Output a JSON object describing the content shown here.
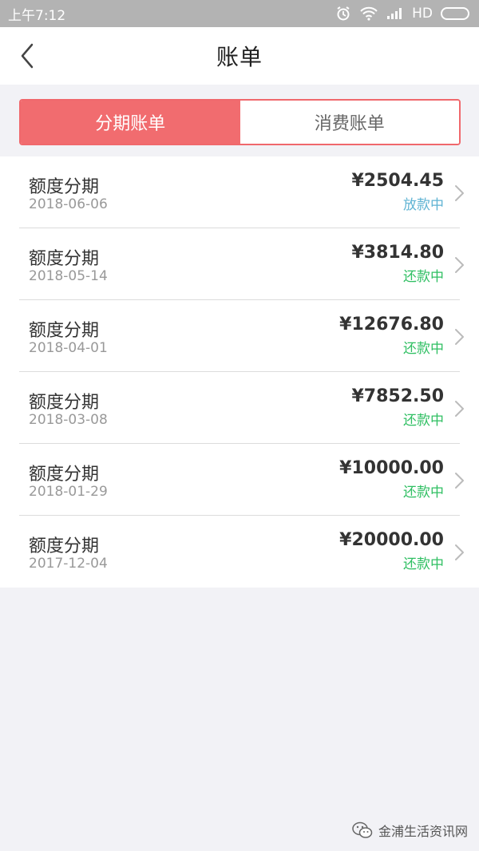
{
  "status_bar": {
    "time": "上午7:12",
    "network": "HD"
  },
  "nav": {
    "title": "账单"
  },
  "tabs": [
    {
      "label": "分期账单",
      "active": true
    },
    {
      "label": "消费账单",
      "active": false
    }
  ],
  "colors": {
    "accent": "#f16c6f",
    "status_disbursing": "#5fb3d3",
    "status_repaying": "#2fbf62"
  },
  "bills": [
    {
      "title": "额度分期",
      "date": "2018-06-06",
      "amount": "¥2504.45",
      "status": "放款中",
      "status_type": "disbursing"
    },
    {
      "title": "额度分期",
      "date": "2018-05-14",
      "amount": "¥3814.80",
      "status": "还款中",
      "status_type": "repaying"
    },
    {
      "title": "额度分期",
      "date": "2018-04-01",
      "amount": "¥12676.80",
      "status": "还款中",
      "status_type": "repaying"
    },
    {
      "title": "额度分期",
      "date": "2018-03-08",
      "amount": "¥7852.50",
      "status": "还款中",
      "status_type": "repaying"
    },
    {
      "title": "额度分期",
      "date": "2018-01-29",
      "amount": "¥10000.00",
      "status": "还款中",
      "status_type": "repaying"
    },
    {
      "title": "额度分期",
      "date": "2017-12-04",
      "amount": "¥20000.00",
      "status": "还款中",
      "status_type": "repaying"
    }
  ],
  "watermark": {
    "text": "金浦生活资讯网"
  }
}
